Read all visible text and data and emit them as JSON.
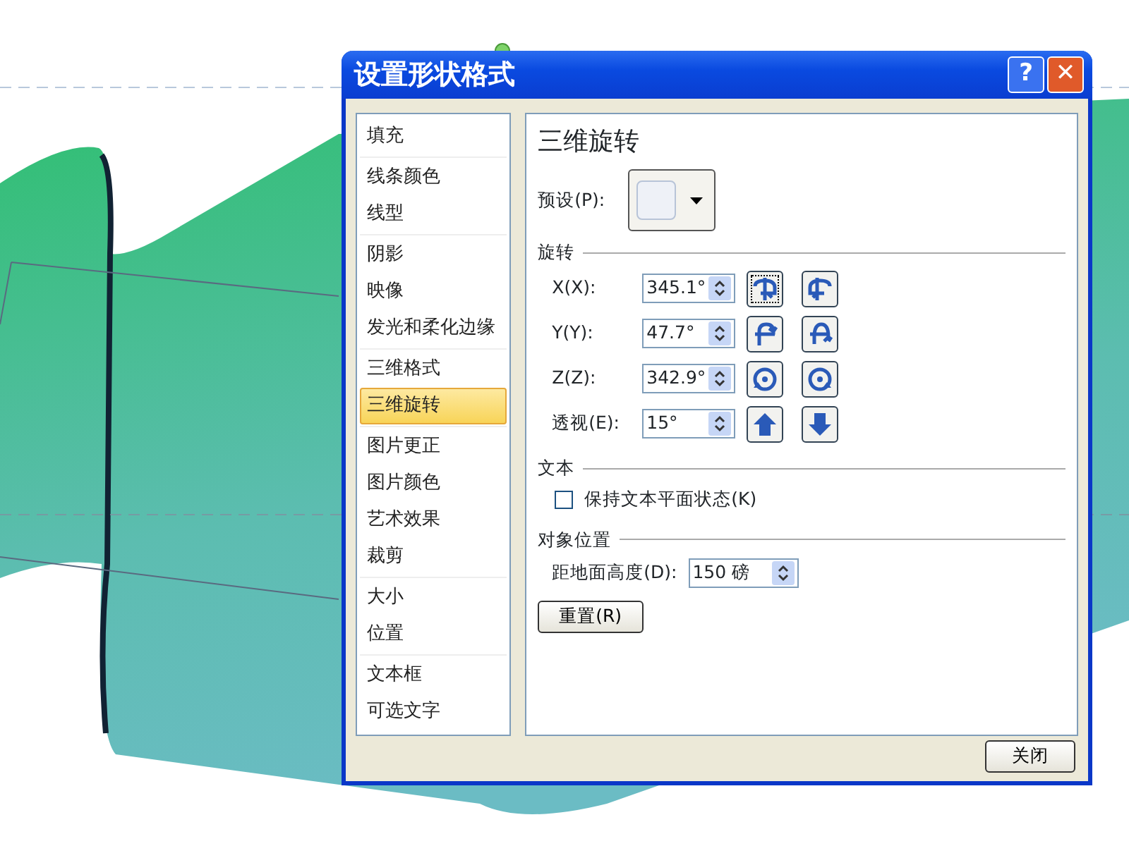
{
  "window": {
    "title": "设置形状格式",
    "buttons": [
      {
        "kind": "help",
        "label": "?"
      },
      {
        "kind": "close",
        "label": "✕"
      }
    ]
  },
  "sidebar": {
    "groups": [
      {
        "items": [
          {
            "label": "填充",
            "selected": false
          }
        ]
      },
      {
        "items": [
          {
            "label": "线条颜色",
            "selected": false
          },
          {
            "label": "线型",
            "selected": false
          }
        ]
      },
      {
        "items": [
          {
            "label": "阴影",
            "selected": false
          },
          {
            "label": "映像",
            "selected": false
          },
          {
            "label": "发光和柔化边缘",
            "selected": false
          }
        ]
      },
      {
        "items": [
          {
            "label": "三维格式",
            "selected": false
          },
          {
            "label": "三维旋转",
            "selected": true
          }
        ]
      },
      {
        "items": [
          {
            "label": "图片更正",
            "selected": false
          },
          {
            "label": "图片颜色",
            "selected": false
          },
          {
            "label": "艺术效果",
            "selected": false
          },
          {
            "label": "裁剪",
            "selected": false
          }
        ]
      },
      {
        "items": [
          {
            "label": "大小",
            "selected": false
          },
          {
            "label": "位置",
            "selected": false
          }
        ]
      },
      {
        "items": [
          {
            "label": "文本框",
            "selected": false
          },
          {
            "label": "可选文字",
            "selected": false
          }
        ]
      }
    ]
  },
  "panel": {
    "title": "三维旋转",
    "preset": {
      "label": "预设(P):"
    },
    "rotation": {
      "heading": "旋转",
      "rows": [
        {
          "label": "X(X):",
          "value": "345.1°"
        },
        {
          "label": "Y(Y):",
          "value": "47.7°"
        },
        {
          "label": "Z(Z):",
          "value": "342.9°"
        },
        {
          "label": "透视(E):",
          "value": "15°"
        }
      ]
    },
    "text": {
      "heading": "文本",
      "checkbox": {
        "label": "保持文本平面状态(K)",
        "checked": false
      }
    },
    "position": {
      "heading": "对象位置",
      "field": {
        "label": "距地面高度(D):",
        "value": "150 磅"
      }
    },
    "reset_button": "重置(R)"
  },
  "close_button": "关闭"
}
